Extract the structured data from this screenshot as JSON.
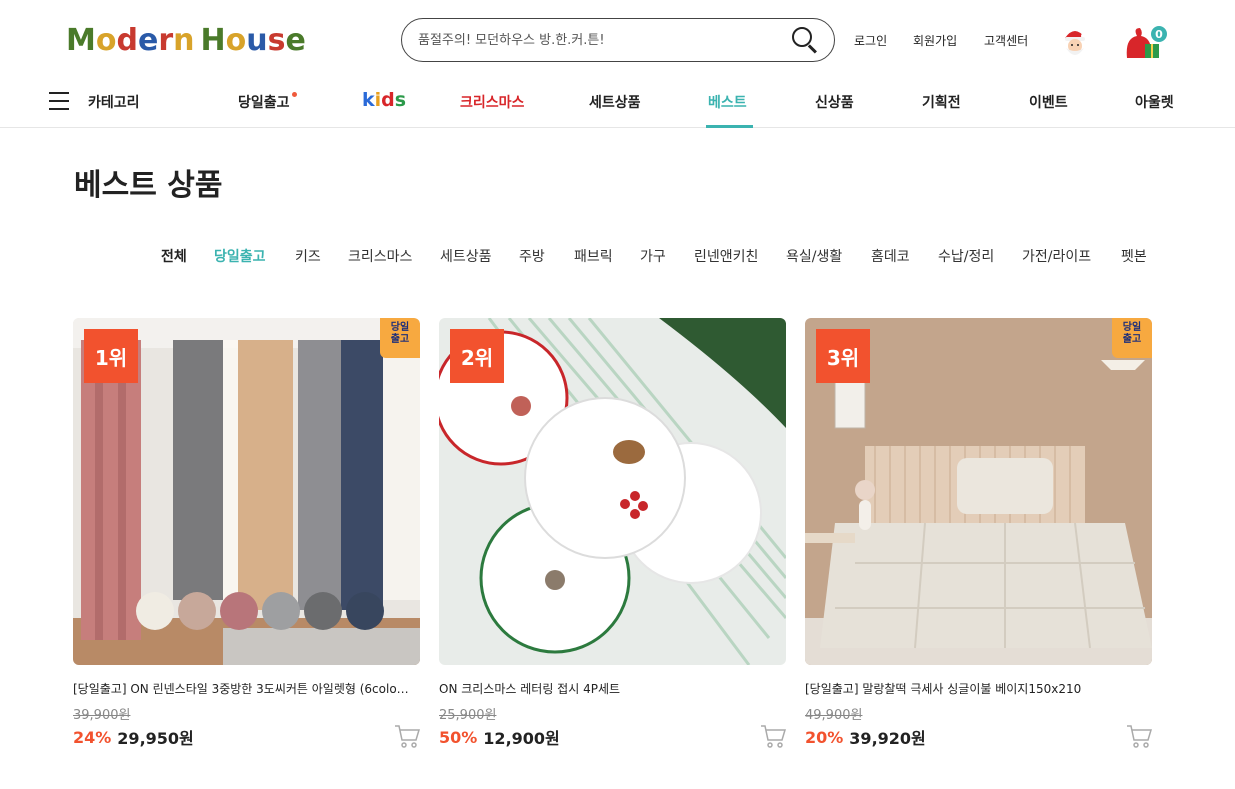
{
  "header": {
    "logo": "ModernHouse",
    "search_placeholder": "품절주의! 모던하우스 방.한.커.튼!",
    "links": [
      "로그인",
      "회원가입",
      "고객센터"
    ],
    "cart_count": "0"
  },
  "nav": {
    "category_label": "카테고리",
    "items": [
      "당일출고",
      "kids",
      "크리스마스",
      "세트상품",
      "베스트",
      "신상품",
      "기획전",
      "이벤트",
      "아울렛"
    ],
    "active": "베스트"
  },
  "page_title": "베스트 상품",
  "filters": [
    "전체",
    "당일출고",
    "키즈",
    "크리스마스",
    "세트상품",
    "주방",
    "패브릭",
    "가구",
    "린넨앤키친",
    "욕실/생활",
    "홈데코",
    "수납/정리",
    "가전/라이프",
    "펫본"
  ],
  "products": [
    {
      "rank": "1위",
      "badge": "당일\n출고",
      "name": "[당일출고] ON 린넨스타일 3중방한 3도씨커튼 아일렛형 (6colo…",
      "original_price": "39,900원",
      "discount": "24%",
      "price": "29,950원",
      "swatches": [
        "#f0ece3",
        "#c7a89a",
        "#b8757a",
        "#9e9fa1",
        "#6b6c6e",
        "#38465e"
      ]
    },
    {
      "rank": "2위",
      "badge": "",
      "name": "ON 크리스마스 레터링 접시 4P세트",
      "original_price": "25,900원",
      "discount": "50%",
      "price": "12,900원"
    },
    {
      "rank": "3위",
      "badge": "당일\n출고",
      "name": "[당일출고] 말랑찰떡 극세사 싱글이불 베이지150x210",
      "original_price": "49,900원",
      "discount": "20%",
      "price": "39,920원"
    }
  ],
  "colors": {
    "accent": "#3bb3b0",
    "rank": "#f2522e",
    "badge": "#f7a940"
  }
}
